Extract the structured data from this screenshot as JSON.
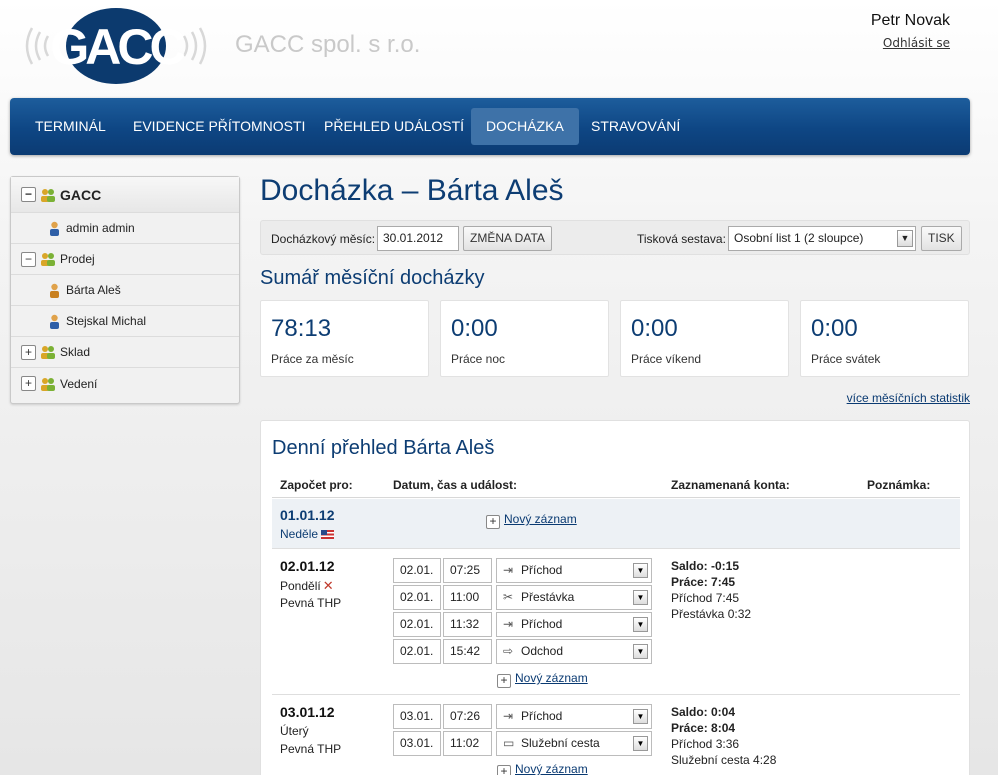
{
  "header": {
    "company_name": "GACC spol. s r.o.",
    "logo_text": "GACC",
    "user_name": "Petr Novak",
    "logout_label": "Odhlásit se"
  },
  "nav": {
    "items": [
      {
        "label": "TERMINÁL"
      },
      {
        "label": "EVIDENCE PŘÍTOMNOSTI"
      },
      {
        "label": "PŘEHLED UDÁLOSTÍ"
      },
      {
        "label": "DOCHÁZKA",
        "active": true
      },
      {
        "label": "STRAVOVÁNÍ"
      }
    ]
  },
  "sidebar": {
    "root": {
      "label": "GACC",
      "toggle": "−"
    },
    "items": [
      {
        "label": "admin admin",
        "type": "person"
      },
      {
        "label": "Prodej",
        "type": "group",
        "toggle": "−"
      },
      {
        "label": "Bárta Aleš",
        "type": "person"
      },
      {
        "label": "Stejskal Michal",
        "type": "person"
      },
      {
        "label": "Sklad",
        "type": "group",
        "toggle": "+"
      },
      {
        "label": "Vedení",
        "type": "group",
        "toggle": "+"
      }
    ]
  },
  "main": {
    "title": "Docházka – Bárta Aleš",
    "filter": {
      "month_label": "Docházkový měsíc:",
      "month_value": "30.01.2012",
      "change_button": "ZMĚNA DATA",
      "report_label": "Tisková sestava:",
      "report_value": "Osobní list 1 (2 sloupce)",
      "print_button": "TISK"
    },
    "summary_title": "Sumář měsíční docházky",
    "stats": [
      {
        "value": "78:13",
        "label": "Práce za měsíc"
      },
      {
        "value": "0:00",
        "label": "Práce noc"
      },
      {
        "value": "0:00",
        "label": "Práce víkend"
      },
      {
        "value": "0:00",
        "label": "Práce svátek"
      }
    ],
    "more_stats_link": "více měsíčních statistik"
  },
  "daily": {
    "title": "Denní přehled Bárta Aleš",
    "columns": {
      "counted_for": "Započet pro:",
      "datetime_event": "Datum, čas a událost:",
      "accounts": "Zaznamenaná konta:",
      "note": "Poznámka:"
    },
    "new_record_label": "Nový záznam",
    "days": [
      {
        "date": "01.01.12",
        "day_name": "Neděle",
        "plan": "",
        "entries": [],
        "accounts": []
      },
      {
        "date": "02.01.12",
        "day_name": "Pondělí",
        "plan": "Pevná THP",
        "entries": [
          {
            "date": "02.01.",
            "time": "07:25",
            "event": "Příchod",
            "icon": "arrival-icon"
          },
          {
            "date": "02.01.",
            "time": "11:00",
            "event": "Přestávka",
            "icon": "break-icon"
          },
          {
            "date": "02.01.",
            "time": "11:32",
            "event": "Příchod",
            "icon": "arrival-icon"
          },
          {
            "date": "02.01.",
            "time": "15:42",
            "event": "Odchod",
            "icon": "departure-icon"
          }
        ],
        "accounts": [
          {
            "text": "Saldo: -0:15",
            "bold": true
          },
          {
            "text": "Práce: 7:45",
            "bold": true
          },
          {
            "text": "Příchod 7:45",
            "bold": false
          },
          {
            "text": "Přestávka 0:32",
            "bold": false
          }
        ]
      },
      {
        "date": "03.01.12",
        "day_name": "Úterý",
        "plan": "Pevná THP",
        "entries": [
          {
            "date": "03.01.",
            "time": "07:26",
            "event": "Příchod",
            "icon": "arrival-icon"
          },
          {
            "date": "03.01.",
            "time": "11:02",
            "event": "Služební cesta",
            "icon": "briefcase-icon"
          }
        ],
        "accounts": [
          {
            "text": "Saldo: 0:04",
            "bold": true
          },
          {
            "text": "Práce: 8:04",
            "bold": true
          },
          {
            "text": "Příchod 3:36",
            "bold": false
          },
          {
            "text": "Služební cesta 4:28",
            "bold": false
          }
        ]
      }
    ]
  }
}
